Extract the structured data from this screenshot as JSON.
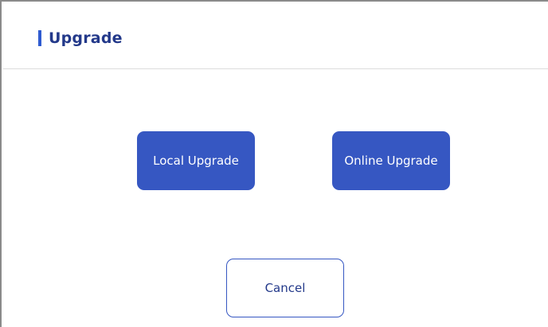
{
  "dialog": {
    "title": "Upgrade",
    "accent_color": "#2f5bd0",
    "buttons": {
      "local_upgrade": "Local Upgrade",
      "online_upgrade": "Online Upgrade",
      "cancel": "Cancel"
    },
    "colors": {
      "primary_button": "#3657c2",
      "title_text": "#23398a"
    }
  }
}
